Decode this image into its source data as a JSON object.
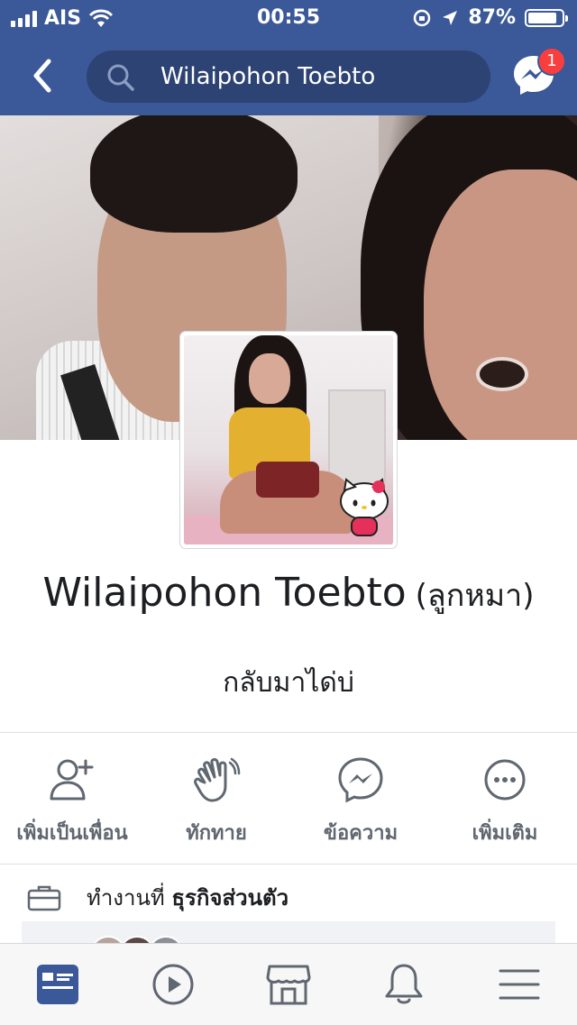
{
  "status_bar": {
    "carrier": "AIS",
    "time": "00:55",
    "battery_percent": "87%",
    "battery_level": 0.87
  },
  "header": {
    "search_text": "Wilaipohon Toebto",
    "messenger_badge": "1",
    "color": "#3b5998"
  },
  "profile": {
    "name": "Wilaipohon Toebto",
    "nickname": "(ลูกหมา)",
    "bio": "กลับมาได่บ่"
  },
  "actions": [
    {
      "label": "เพิ่มเป็นเพื่อน",
      "icon": "add-friend-icon"
    },
    {
      "label": "ทักทาย",
      "icon": "wave-icon"
    },
    {
      "label": "ข้อความ",
      "icon": "messenger-icon"
    },
    {
      "label": "เพิ่มเติม",
      "icon": "more-icon"
    }
  ],
  "work": {
    "prefix": "ทำงานที่",
    "place": "ธุรกิจส่วนตัว",
    "icon": "briefcase-icon"
  },
  "tabbar": [
    {
      "name": "news-feed",
      "icon": "news-feed-icon",
      "active": true
    },
    {
      "name": "watch",
      "icon": "video-play-icon",
      "active": false
    },
    {
      "name": "marketplace",
      "icon": "marketplace-icon",
      "active": false
    },
    {
      "name": "notifications",
      "icon": "bell-icon",
      "active": false
    },
    {
      "name": "menu",
      "icon": "hamburger-menu-icon",
      "active": false
    }
  ],
  "colors": {
    "accent": "#3b5998",
    "badge": "#fa3e3e",
    "icon_gray": "#606770"
  }
}
